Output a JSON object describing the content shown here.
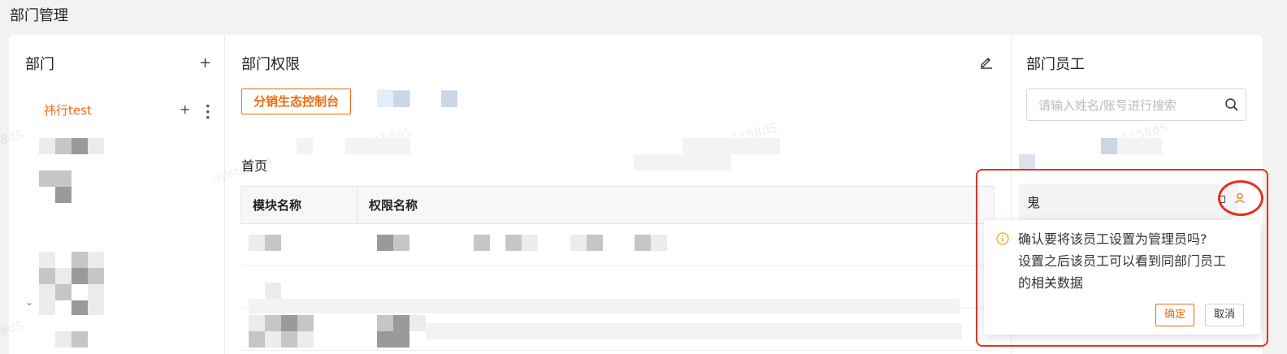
{
  "page": {
    "title": "部门管理"
  },
  "departments": {
    "title": "部门",
    "add_symbol": "+",
    "items": [
      {
        "label": "祎行test"
      }
    ]
  },
  "permissions": {
    "title": "部门权限",
    "active_tab": "分销生态控制台",
    "section_label": "首页",
    "table": {
      "headers": [
        "模块名称",
        "权限名称"
      ]
    }
  },
  "staff": {
    "title": "部门员工",
    "search_placeholder": "请输入姓名/账号进行搜索",
    "rows": [
      {
        "name": "鬼"
      }
    ]
  },
  "popconfirm": {
    "line1": "确认要将该员工设置为管理员吗?",
    "line2": "设置之后该员工可以看到同部门员工",
    "line3": "的相关数据",
    "ok_label": "确定",
    "cancel_label": "取消"
  },
  "colors": {
    "accent": "#f06a0f",
    "annotation": "#e5311f",
    "info": "#f2a80c"
  }
}
